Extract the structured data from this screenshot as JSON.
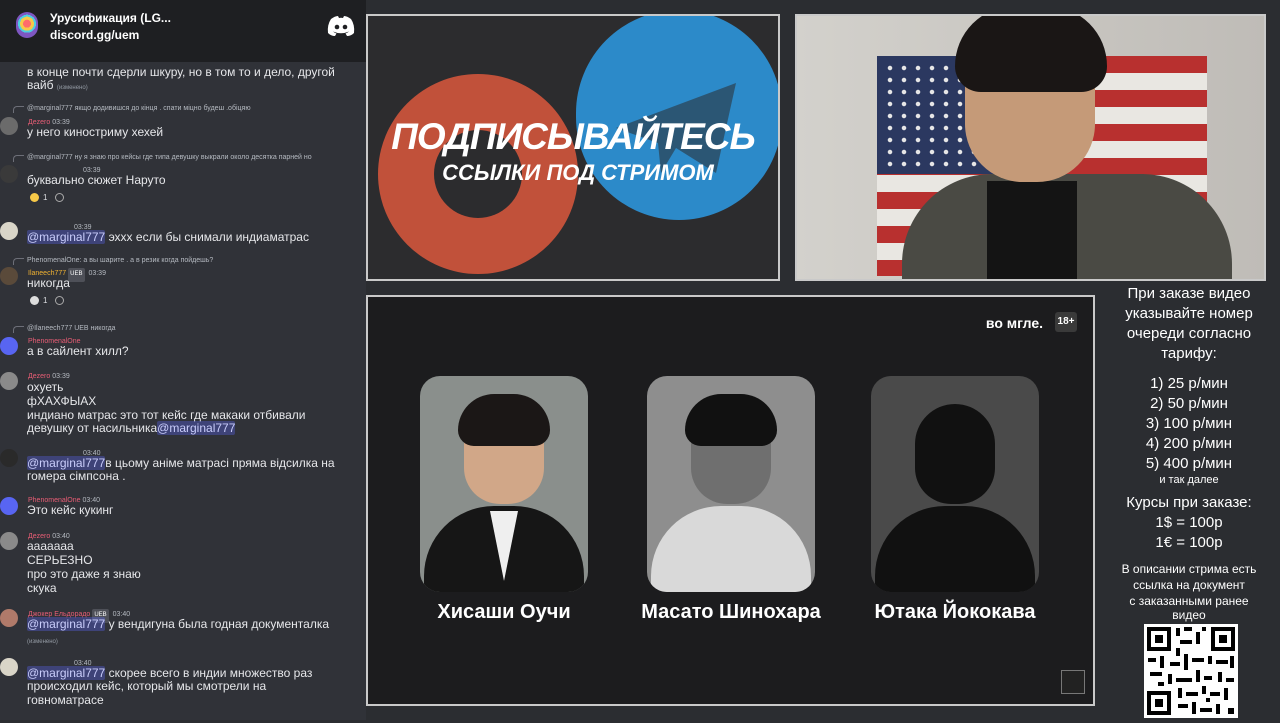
{
  "server": {
    "name": "Урусификация (LG...",
    "link": "discord.gg/uem"
  },
  "chat": {
    "top_text_1": "в конце почти сдерли шкуру, но в том то и дело, другой",
    "top_text_2": "вайб",
    "top_edited": "(изменено)",
    "m1_reply": "@marginal777 якщо додивишся до кінця . спати міцно будеш .обіцяю",
    "m1_user": "Дezero",
    "m1_time": "03:39",
    "m1_text": "у него киностриму хехей",
    "m2_reply": "@marginal777 ну я знаю про кейсы где типа девушку выкрали около десятка парней но",
    "m2_time": "03:39",
    "m2_text": "буквально сюжет Наруто",
    "m2_react": "1",
    "m3_time": "03:39",
    "m3_mention": "@marginal777",
    "m3_text": " эхxx если бы снимали индиаматрас",
    "m4_reply": "PhenomenalOne: а вы шарите  . а в резик когда пойдешь?",
    "m4_user": "Ilaneech777",
    "m4_tag": "UEB",
    "m4_time": "03:39",
    "m4_text": "никогда",
    "m4_react": "1",
    "m5_reply": "@Ilaneech777 UEB никогда",
    "m5_user": "PhenomenalOne",
    "m5_text": "а в сайлент хилл?",
    "m6_user": "Дezero",
    "m6_time": "03:39",
    "m6_text_1": "охуеть",
    "m6_text_2": "фХАХФЫАХ",
    "m6_text_3": "индиано матрас это тот кейс где макаки отбивали",
    "m6_text_4": "девушку от насильника",
    "m6_mention": "@marginal777",
    "m7_time": "03:40",
    "m7_mention": "@marginal777",
    "m7_text_1": "в цьому аніме матрасі пряма відсилка на",
    "m7_text_2": "гомера сімпсона .",
    "m8_user": "PhenomenalOne",
    "m8_time": "03:40",
    "m8_text": "Это кейс кукинг",
    "m9_user": "Дezero",
    "m9_time": "03:40",
    "m9_text_1": "ааааааа",
    "m9_text_2": "СЕРЬЕЗНО",
    "m9_text_3": "про это даже я знаю",
    "m9_text_4": "скука",
    "m10_user": "Джокер Ельдорадо",
    "m10_tag": "UEB",
    "m10_time": "03:40",
    "m10_mention": "@marginal777",
    "m10_text": " у вендигуна была годная документалка",
    "m10_edited": "(изменено)",
    "m11_time": "03:40",
    "m11_mention": "@marginal777",
    "m11_text_1": " скорее всего в индии множество раз",
    "m11_text_2": "происходил кейс, который мы смотрели на",
    "m11_text_3": "говноматрасе"
  },
  "promo": {
    "line1": "ПОДПИСЫВАЙТЕСЬ",
    "line2": "ССЫЛКИ ПОД СТРИМОМ"
  },
  "video": {
    "channel": "во мгле.",
    "age": "18+",
    "people": [
      "Хисаши Оучи",
      "Масато Шинохара",
      "Ютака Йококава"
    ]
  },
  "info": {
    "heading": [
      "При заказе видео",
      "указывайте номер",
      "очереди согласно",
      "тарифу:"
    ],
    "rates": [
      "1) 25 р/мин",
      "2) 50 р/мин",
      "3) 100 р/мин",
      "4) 200 р/мин",
      "5) 400 р/мин"
    ],
    "more": "и так далее",
    "cur_heading": "Курсы при заказе:",
    "cur": [
      "1$ = 100р",
      "1€ = 100р"
    ],
    "desc": [
      "В описании стрима есть",
      "ссылка на документ",
      "с заказанными ранее",
      "видео"
    ]
  },
  "colors": {
    "discord_blurple": "#5865f2",
    "mention_text": "#c9cdfb",
    "bg": "#2b2d31"
  }
}
